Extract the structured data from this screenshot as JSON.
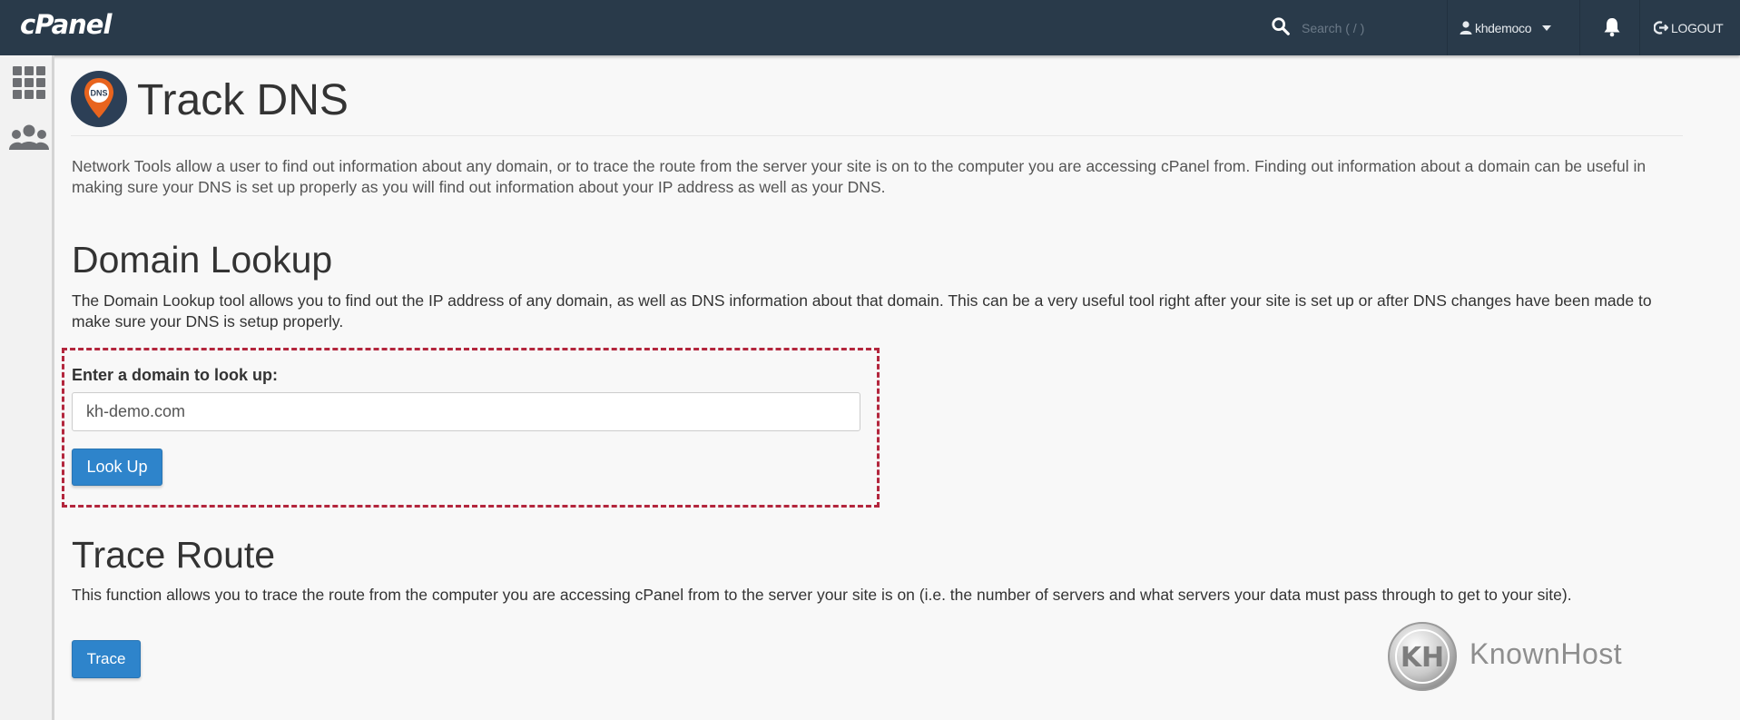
{
  "header": {
    "logo": "cPanel",
    "search_placeholder": "Search ( / )",
    "username": "khdemoco",
    "logout_label": "LOGOUT"
  },
  "sidebar": {
    "items": [
      {
        "icon": "apps-grid-icon"
      },
      {
        "icon": "users-icon"
      }
    ]
  },
  "page": {
    "title": "Track DNS",
    "icon_text": "DNS",
    "intro": "Network Tools allow a user to find out information about any domain, or to trace the route from the server your site is on to the computer you are accessing cPanel from. Finding out information about a domain can be useful in making sure your DNS is set up properly as you will find out information about your IP address as well as your DNS."
  },
  "domain_lookup": {
    "heading": "Domain Lookup",
    "description": "The Domain Lookup tool allows you to find out the IP address of any domain, as well as DNS information about that domain. This can be a very useful tool right after your site is set up or after DNS changes have been made to make sure your DNS is setup properly.",
    "field_label": "Enter a domain to look up:",
    "field_value": "kh-demo.com",
    "button_label": "Look Up"
  },
  "trace_route": {
    "heading": "Trace Route",
    "description": "This function allows you to trace the route from the computer you are accessing cPanel from to the server your site is on (i.e. the number of servers and what servers your data must pass through to get to your site).",
    "button_label": "Trace"
  },
  "watermark": {
    "text": "KnownHost",
    "logo_text": "KH"
  },
  "colors": {
    "topbar": "#293a4a",
    "button": "#2e84cb",
    "highlight_border": "#b3263d",
    "dns_pin": "#e8641e"
  }
}
